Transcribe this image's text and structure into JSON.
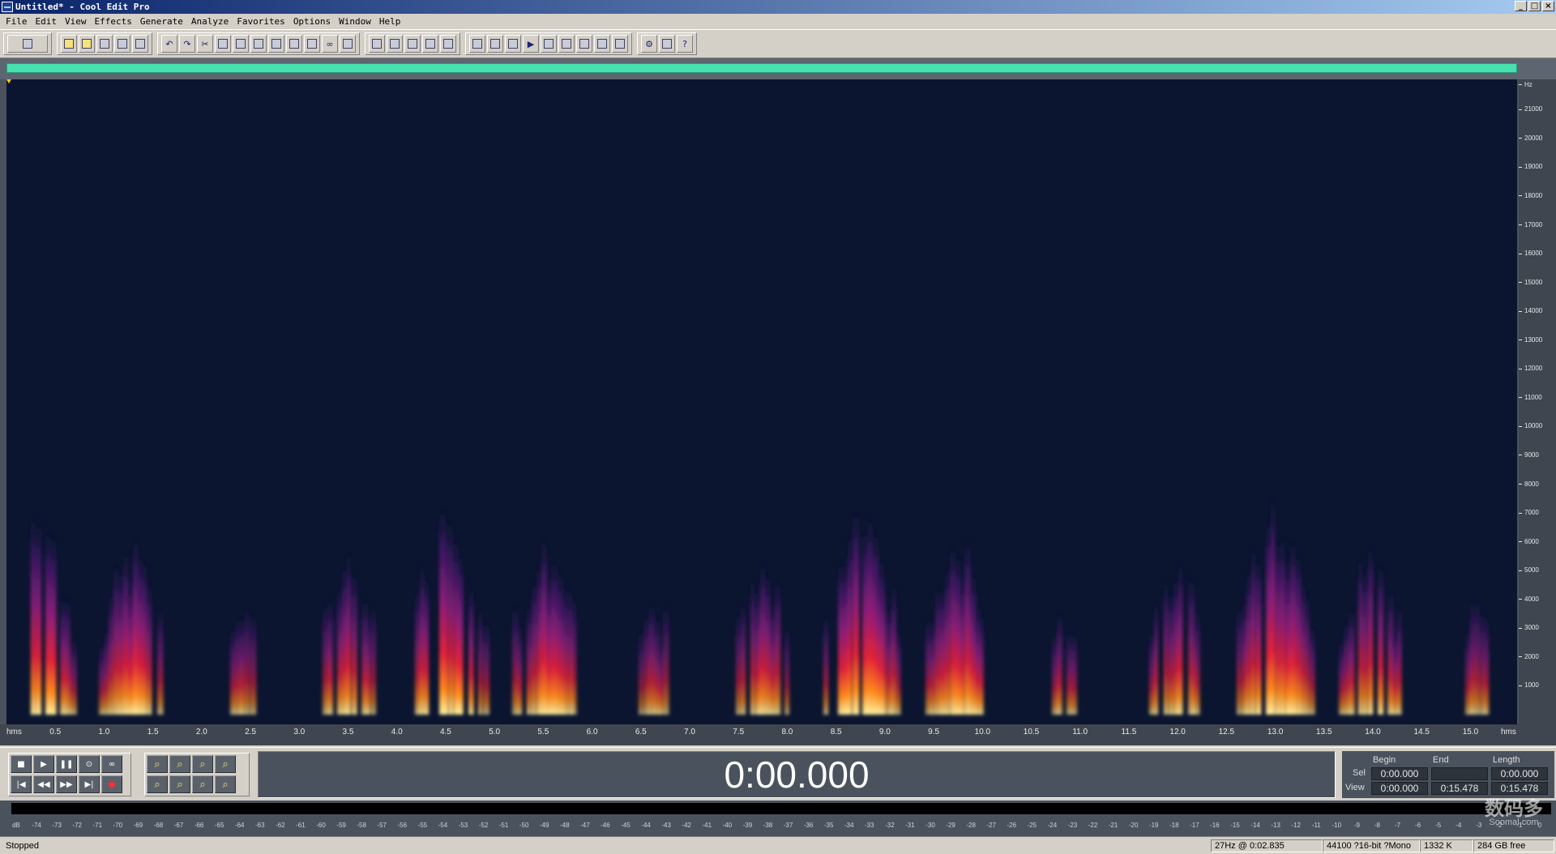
{
  "window": {
    "title": "Untitled* - Cool Edit Pro",
    "controls": [
      "_",
      "□",
      "×"
    ]
  },
  "menu": [
    "File",
    "Edit",
    "View",
    "Effects",
    "Generate",
    "Analyze",
    "Favorites",
    "Options",
    "Window",
    "Help"
  ],
  "toolbar": {
    "groups": [
      [
        "mode-toggle-icon"
      ],
      [
        "new-icon",
        "open-icon",
        "save-icon",
        "save-all-icon",
        "close-file-icon"
      ],
      [
        "undo-icon",
        "redo-icon",
        "cut-icon",
        "copy-icon",
        "paste-icon",
        "mix-paste-icon",
        "trim-icon",
        "delete-icon",
        "insert-icon",
        "loop-icon",
        "cd-icon"
      ],
      [
        "waveform-view-icon",
        "spectral-view-icon",
        "grid-icon",
        "grid2-icon",
        "grid3-icon"
      ],
      [
        "frame1-icon",
        "frame2-icon",
        "frame3-icon",
        "play-view-icon",
        "zoom-frame-icon",
        "counter-icon",
        "meter-icon",
        "cue-icon",
        "panel-icon"
      ],
      [
        "settings-icon",
        "about-icon",
        "help-icon"
      ]
    ]
  },
  "spectral": {
    "freq_axis": {
      "unit": "Hz",
      "ticks": [
        21000,
        20000,
        19000,
        18000,
        17000,
        16000,
        15000,
        14000,
        13000,
        12000,
        11000,
        10000,
        9000,
        8000,
        7000,
        6000,
        5000,
        4000,
        3000,
        2000,
        1000
      ],
      "max": 22050
    },
    "time_axis": {
      "unit_left": "hms",
      "unit_right": "hms",
      "ticks": [
        "0.5",
        "1.0",
        "1.5",
        "2.0",
        "2.5",
        "3.0",
        "3.5",
        "4.0",
        "4.5",
        "5.0",
        "5.5",
        "6.0",
        "6.5",
        "7.0",
        "7.5",
        "8.0",
        "8.5",
        "9.0",
        "9.5",
        "10.0",
        "10.5",
        "11.0",
        "11.5",
        "12.0",
        "12.5",
        "13.0",
        "13.5",
        "14.0",
        "14.5",
        "15.0"
      ],
      "length_seconds": 15.478
    }
  },
  "transport": {
    "row1": [
      "stop-icon",
      "play-icon",
      "pause-icon",
      "play-to-end-icon",
      "loop-play-icon"
    ],
    "row2": [
      "go-begin-icon",
      "rewind-icon",
      "fast-forward-icon",
      "go-end-icon",
      "record-icon"
    ],
    "glyphs": {
      "stop-icon": "■",
      "play-icon": "▶",
      "pause-icon": "❚❚",
      "play-to-end-icon": "⊙",
      "loop-play-icon": "∞",
      "go-begin-icon": "|◀",
      "rewind-icon": "◀◀",
      "fast-forward-icon": "▶▶",
      "go-end-icon": "▶|",
      "record-icon": "●"
    }
  },
  "zoom": {
    "row1": [
      "zoom-in-icon",
      "zoom-out-icon",
      "zoom-full-icon",
      "zoom-vertical-in-icon"
    ],
    "row2": [
      "zoom-left-icon",
      "zoom-right-icon",
      "zoom-sel-icon",
      "zoom-vertical-out-icon"
    ]
  },
  "time_display": "0:00.000",
  "selview": {
    "headers": {
      "begin": "Begin",
      "end": "End",
      "length": "Length"
    },
    "sel": {
      "label": "Sel",
      "begin": "0:00.000",
      "end": "",
      "length": "0:00.000"
    },
    "view": {
      "label": "View",
      "begin": "0:00.000",
      "end": "0:15.478",
      "length": "0:15.478"
    }
  },
  "meter": {
    "ticks": [
      "dB",
      "-74",
      "-73",
      "-72",
      "-71",
      "-70",
      "-69",
      "-68",
      "-67",
      "-66",
      "-65",
      "-64",
      "-63",
      "-62",
      "-61",
      "-60",
      "-59",
      "-58",
      "-57",
      "-56",
      "-55",
      "-54",
      "-53",
      "-52",
      "-51",
      "-50",
      "-49",
      "-48",
      "-47",
      "-46",
      "-45",
      "-44",
      "-43",
      "-42",
      "-41",
      "-40",
      "-39",
      "-38",
      "-37",
      "-36",
      "-35",
      "-34",
      "-33",
      "-32",
      "-31",
      "-30",
      "-29",
      "-28",
      "-27",
      "-26",
      "-25",
      "-24",
      "-23",
      "-22",
      "-21",
      "-20",
      "-19",
      "-18",
      "-17",
      "-16",
      "-15",
      "-14",
      "-13",
      "-12",
      "-11",
      "-10",
      "-9",
      "-8",
      "-7",
      "-6",
      "-5",
      "-4",
      "-3",
      "-2",
      "-1",
      "0"
    ]
  },
  "status": {
    "state": "Stopped",
    "cursor": "27Hz @   0:02.835",
    "format": "44100 ?16-bit ?Mono",
    "size": "1332 K",
    "free": "284 GB free"
  },
  "watermark": {
    "line1": "数码多",
    "line2": "Soomal.com"
  },
  "colors": {
    "spectral_bg": "#0b1530",
    "overview_range": "#49e0b0",
    "panel_bg": "#4a525d"
  }
}
